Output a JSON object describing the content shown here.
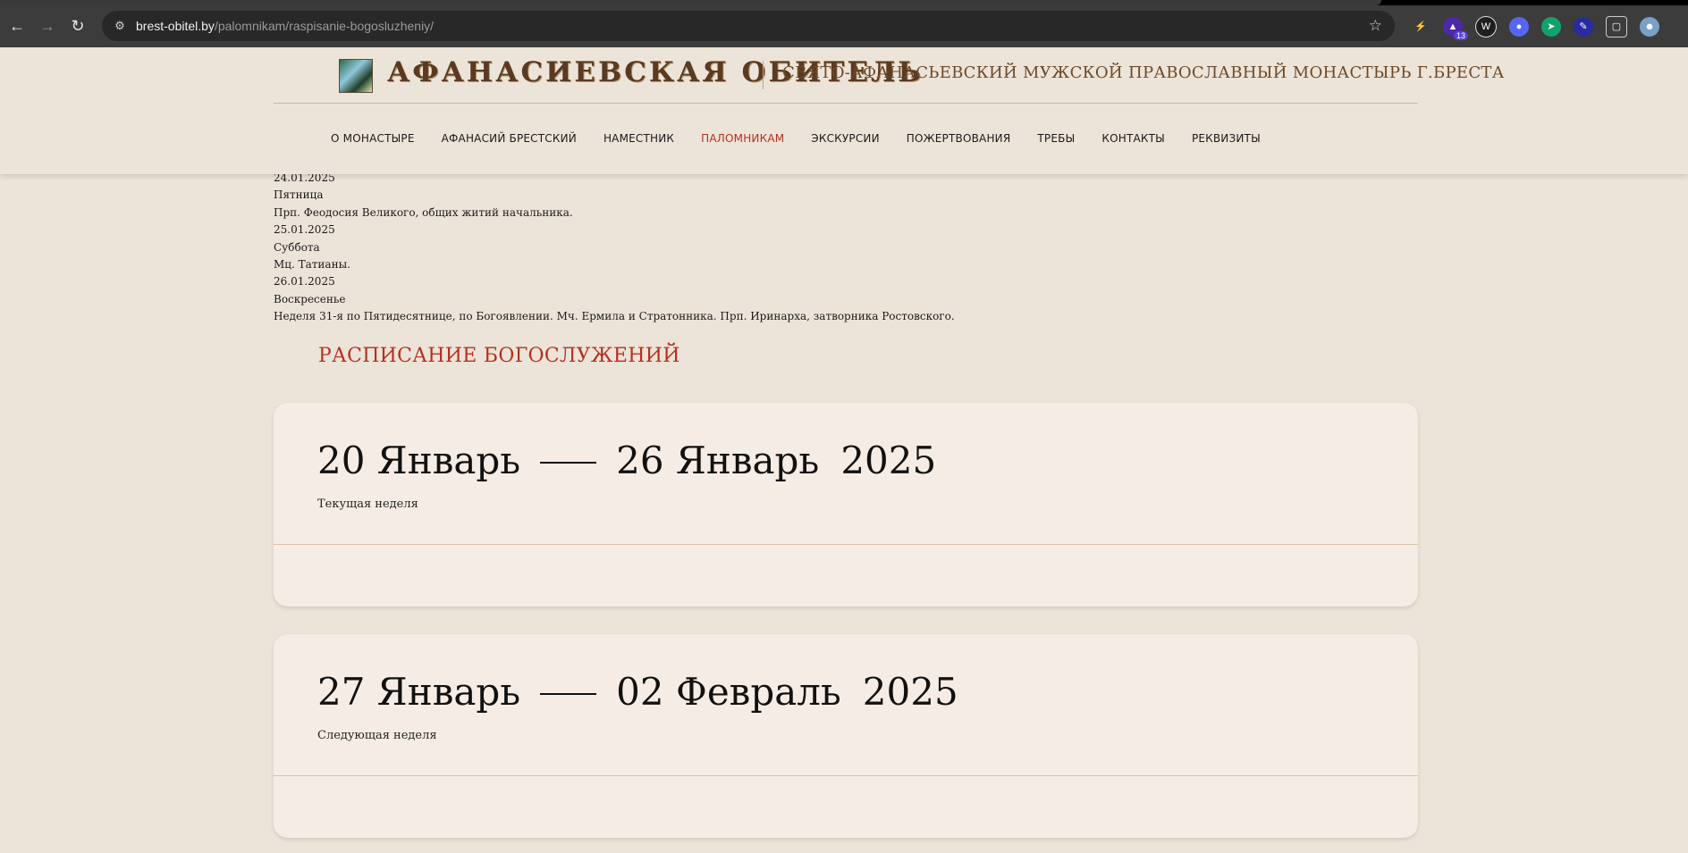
{
  "browser": {
    "url_host": "brest-obitel.by",
    "url_path": "/palomnikam/raspisanie-bogosluzheniy/",
    "extension_badge": "13",
    "icons": [
      "back-icon",
      "forward-icon",
      "reload-icon",
      "site-settings-icon",
      "bookmark-star-icon",
      "extensions-icon",
      "profile-avatar-icon"
    ]
  },
  "site": {
    "logo_text": "АФАНАСИЕВСКАЯ ОБИТЕЛЬ",
    "subtitle": "СВЯТО-АФАНАСЬЕВСКИЙ МУЖСКОЙ ПРАВОСЛАВНЫЙ МОНАСТЫРЬ Г.БРЕСТА",
    "nav": [
      {
        "label": "О МОНАСТЫРЕ",
        "active": false
      },
      {
        "label": "АФАНАСИЙ БРЕСТСКИЙ",
        "active": false
      },
      {
        "label": "НАМЕСТНИК",
        "active": false
      },
      {
        "label": "ПАЛОМНИКАМ",
        "active": true
      },
      {
        "label": "ЭКСКУРСИИ",
        "active": false
      },
      {
        "label": "ПОЖЕРТВОВАНИЯ",
        "active": false
      },
      {
        "label": "ТРЕБЫ",
        "active": false
      },
      {
        "label": "КОНТАКТЫ",
        "active": false
      },
      {
        "label": "РЕКВИЗИТЫ",
        "active": false
      }
    ],
    "accent_color": "#b5301e"
  },
  "days": [
    {
      "date": "24.01.2025",
      "weekday": "Пятница",
      "feast": "Прп. Феодосия Великого, общих житий начальника."
    },
    {
      "date": "25.01.2025",
      "weekday": "Суббота",
      "feast": "Мц. Татианы."
    },
    {
      "date": "26.01.2025",
      "weekday": "Воскресенье",
      "feast": "Неделя 31-я по Пятидесятнице, по Богоявлении. Мч. Ермила и Стратонника. Прп. Иринарха, затворника Ростовского."
    }
  ],
  "section_title": "РАСПИСАНИЕ БОГОСЛУЖЕНИЙ",
  "weeks": [
    {
      "start": "20 Январь",
      "end": "26 Январь",
      "year": "2025",
      "label": "Текущая неделя"
    },
    {
      "start": "27 Январь",
      "end": "02 Февраль",
      "year": "2025",
      "label": "Следующая неделя"
    }
  ]
}
